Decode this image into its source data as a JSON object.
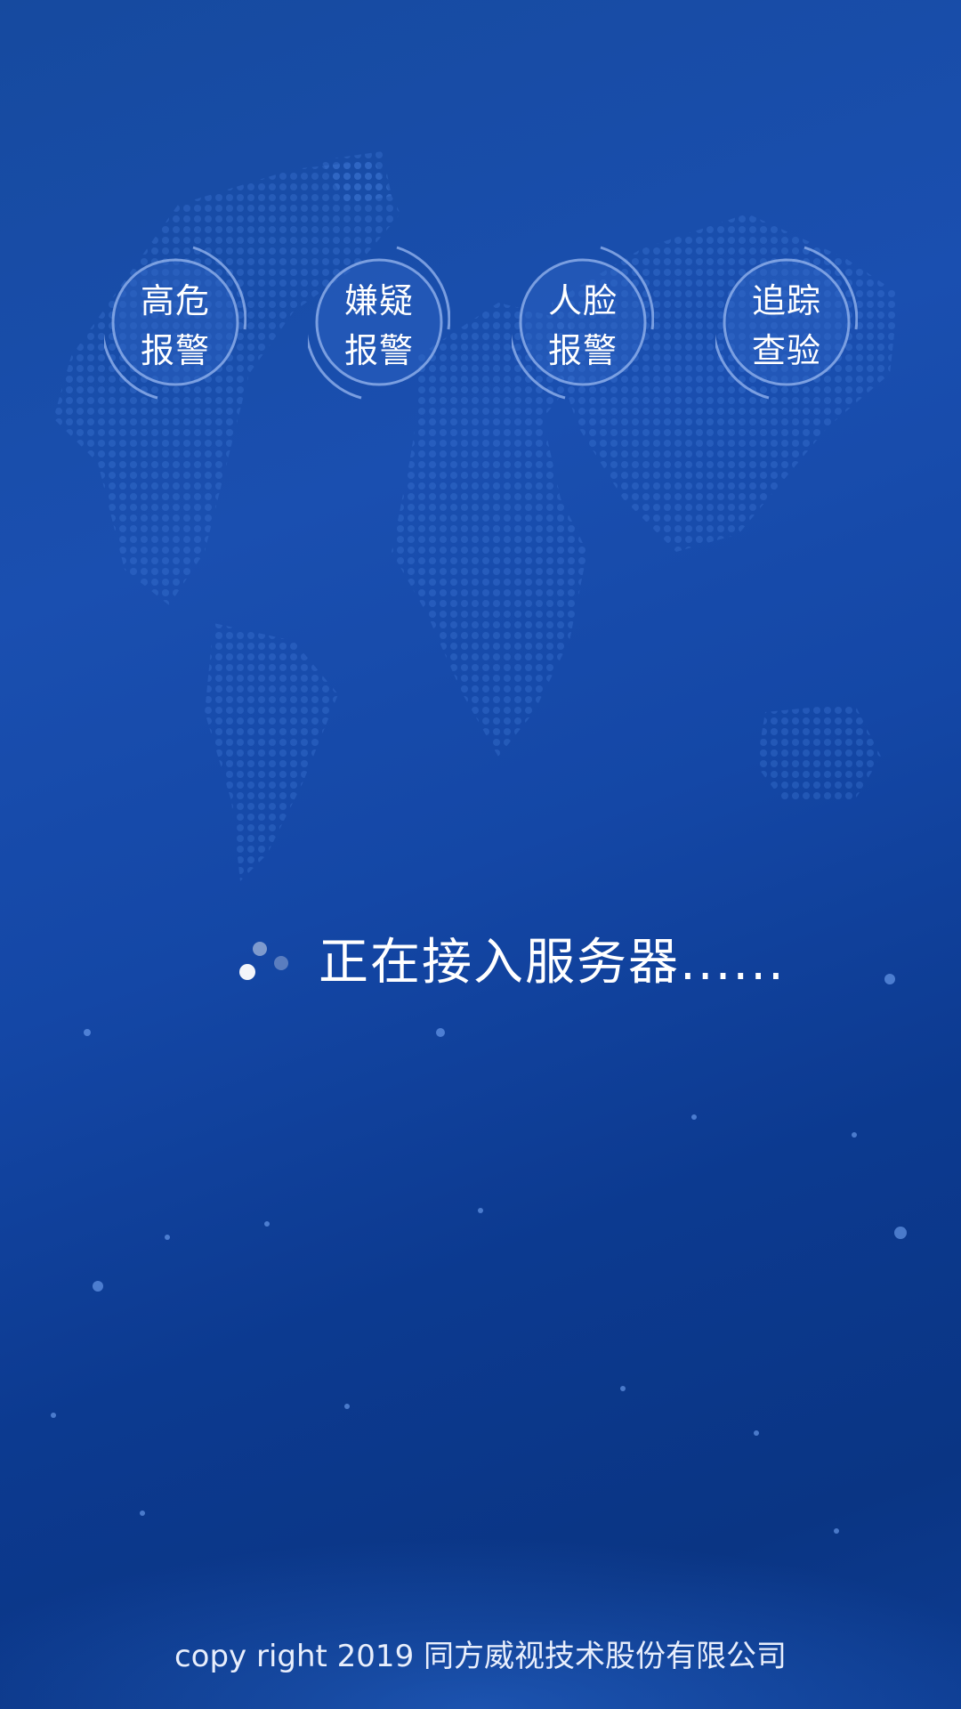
{
  "features": [
    {
      "line1": "高危",
      "line2": "报警"
    },
    {
      "line1": "嫌疑",
      "line2": "报警"
    },
    {
      "line1": "人脸",
      "line2": "报警"
    },
    {
      "line1": "追踪",
      "line2": "查验"
    }
  ],
  "loading": {
    "text": "正在接入服务器......"
  },
  "footer": {
    "copyright": "copy right 2019 同方威视技术股份有限公司"
  },
  "colors": {
    "background": "#1447a6",
    "accent_ring": "#9ab8f0",
    "text": "#ffffff"
  },
  "icons": {
    "spinner": "loading-spinner-icon"
  }
}
